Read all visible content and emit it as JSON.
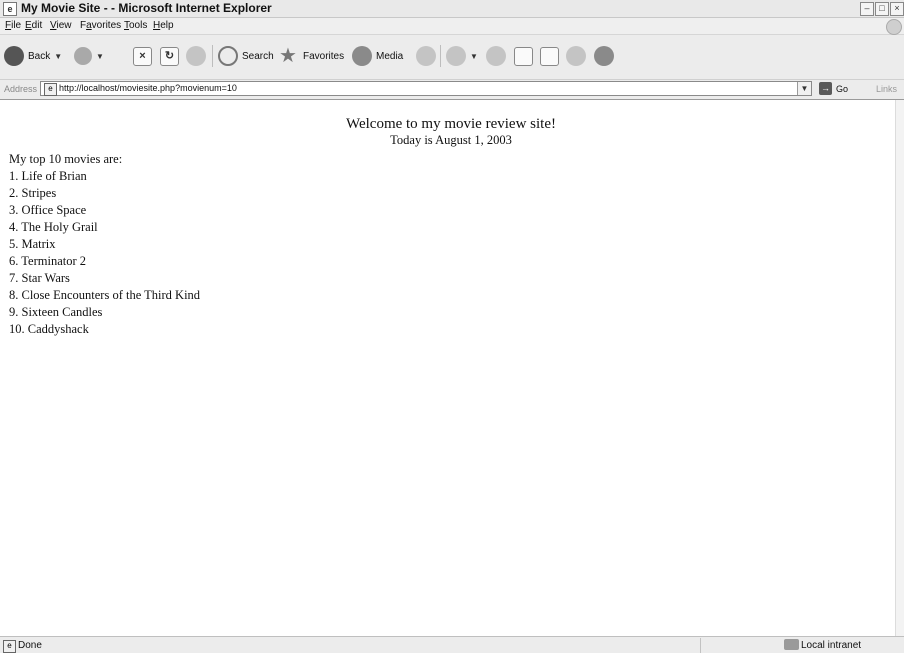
{
  "window": {
    "title": "My Movie Site - - Microsoft Internet Explorer",
    "title_icon": "ie-page-icon",
    "controls": [
      "minimize",
      "maximize",
      "close"
    ]
  },
  "menubar": {
    "items": [
      {
        "label": "File",
        "key": "F",
        "rest": "ile"
      },
      {
        "label": "Edit",
        "key": "E",
        "rest": "dit"
      },
      {
        "label": "View",
        "key": "V",
        "rest": "iew"
      },
      {
        "label": "Favorites",
        "key": "a",
        "pre": "F",
        "rest": "vorites"
      },
      {
        "label": "Tools",
        "key": "T",
        "rest": "ools"
      },
      {
        "label": "Help",
        "key": "H",
        "rest": "elp"
      }
    ]
  },
  "toolbar": {
    "back_label": "Back",
    "search_label": "Search",
    "favorites_label": "Favorites",
    "media_label": "Media"
  },
  "address": {
    "label": "Address",
    "url": "http://localhost/moviesite.php?movienum=10",
    "go_label": "Go",
    "links_label": "Links"
  },
  "page": {
    "welcome": "Welcome to my movie review site!",
    "today": "Today is August 1, 2003",
    "intro": "My top 10 movies are:",
    "movies": [
      "1. Life of Brian",
      "2. Stripes",
      "3. Office Space",
      "4. The Holy Grail",
      "5. Matrix",
      "6. Terminator 2",
      "7. Star Wars",
      "8. Close Encounters of the Third Kind",
      "9. Sixteen Candles",
      "10. Caddyshack"
    ]
  },
  "status": {
    "text": "Done",
    "zone": "Local intranet"
  }
}
